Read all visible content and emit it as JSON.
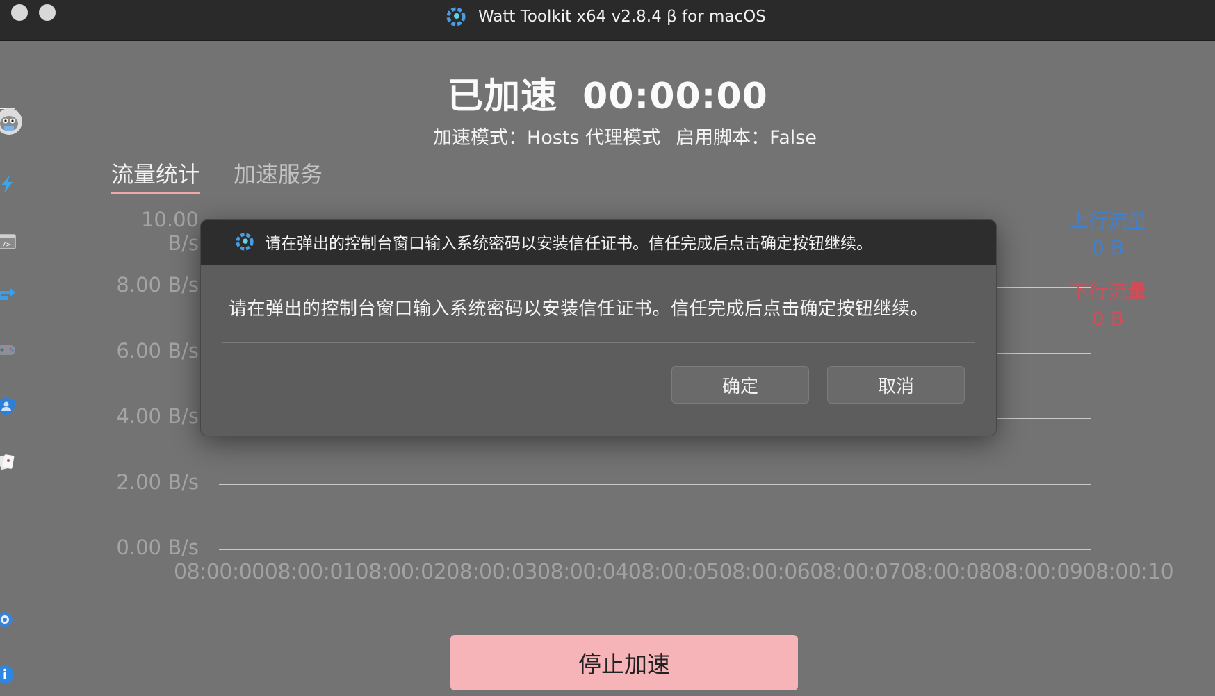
{
  "window": {
    "title": "Watt Toolkit x64 v2.8.4 β for macOS"
  },
  "sidebar": {
    "items": [
      {
        "icon": "menu-icon"
      },
      {
        "icon": "avatar"
      },
      {
        "icon": "lightning-icon"
      },
      {
        "icon": "script-icon"
      },
      {
        "icon": "account-switch-icon"
      },
      {
        "icon": "gamepad-icon"
      },
      {
        "icon": "shield-user-icon"
      },
      {
        "icon": "cards-icon"
      },
      {
        "icon": "settings-icon"
      },
      {
        "icon": "info-icon"
      }
    ]
  },
  "header": {
    "status": "已加速",
    "timer": "00:00:00",
    "mode_label": "加速模式：Hosts 代理模式",
    "script_label": "启用脚本：False"
  },
  "tabs": [
    {
      "label": "流量统计",
      "active": true
    },
    {
      "label": "加速服务",
      "active": false
    }
  ],
  "chart_data": {
    "type": "line",
    "title": "",
    "y_ticks": [
      "10.00 B/s",
      "8.00 B/s",
      "6.00 B/s",
      "4.00 B/s",
      "2.00 B/s",
      "0.00 B/s"
    ],
    "x_ticks": [
      "08:00:00",
      "08:00:01",
      "08:00:02",
      "08:00:03",
      "08:00:04",
      "08:00:05",
      "08:00:06",
      "08:00:07",
      "08:00:08",
      "08:00:09",
      "08:00:10"
    ],
    "ylim": [
      0,
      10
    ],
    "grid": true,
    "legend_placement": "right",
    "series": [
      {
        "name": "上行流量",
        "total": "0 B",
        "color": "#3b82d6",
        "values": [
          0,
          0,
          0,
          0,
          0,
          0,
          0,
          0,
          0,
          0,
          0
        ]
      },
      {
        "name": "下行流量",
        "total": "0 B",
        "color": "#d44c57",
        "values": [
          0,
          0,
          0,
          0,
          0,
          0,
          0,
          0,
          0,
          0,
          0
        ]
      }
    ]
  },
  "stop_button": {
    "label": "停止加速"
  },
  "dialog": {
    "title": "请在弹出的控制台窗口输入系统密码以安装信任证书。信任完成后点击确定按钮继续。",
    "message": "请在弹出的控制台窗口输入系统密码以安装信任证书。信任完成后点击确定按钮继续。",
    "ok_label": "确定",
    "cancel_label": "取消"
  },
  "colors": {
    "accent_pink": "#f7b4b8",
    "upload_blue": "#3b82d6",
    "download_red": "#d44c57"
  }
}
